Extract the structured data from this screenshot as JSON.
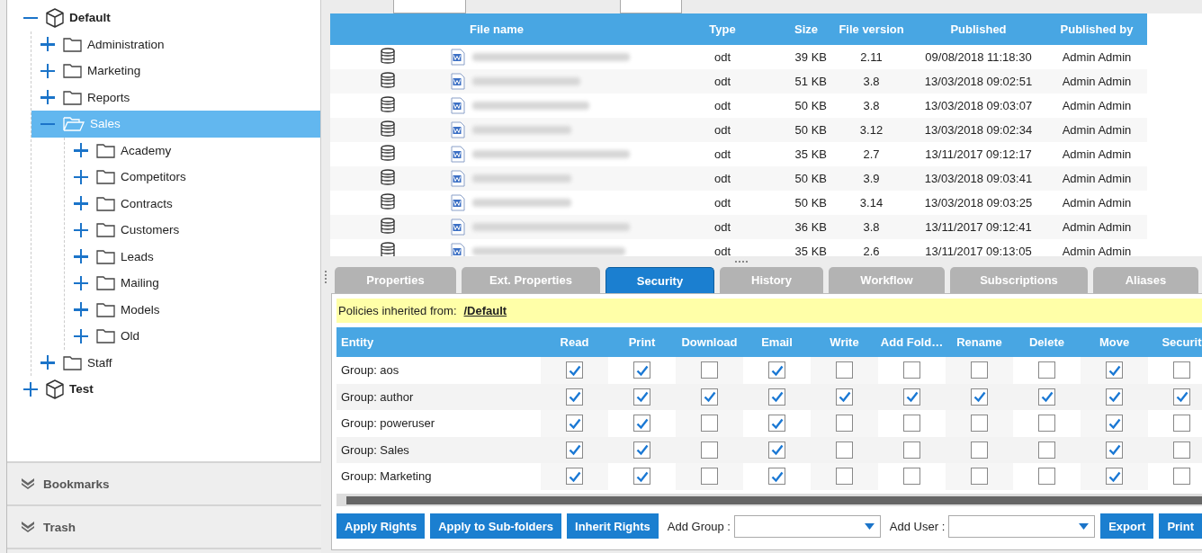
{
  "tree": [
    {
      "label": "Default",
      "kind": "repository",
      "expanded": true,
      "selected": false,
      "children": [
        {
          "label": "Administration",
          "kind": "folder",
          "expanded": false,
          "selected": false
        },
        {
          "label": "Marketing",
          "kind": "folder",
          "expanded": false,
          "selected": false
        },
        {
          "label": "Reports",
          "kind": "folder",
          "expanded": false,
          "selected": false
        },
        {
          "label": "Sales",
          "kind": "folder",
          "expanded": true,
          "selected": true,
          "children": [
            {
              "label": "Academy",
              "kind": "folder",
              "expanded": false,
              "selected": false
            },
            {
              "label": "Competitors",
              "kind": "folder",
              "expanded": false,
              "selected": false
            },
            {
              "label": "Contracts",
              "kind": "folder",
              "expanded": false,
              "selected": false
            },
            {
              "label": "Customers",
              "kind": "folder",
              "expanded": false,
              "selected": false
            },
            {
              "label": "Leads",
              "kind": "folder",
              "expanded": false,
              "selected": false
            },
            {
              "label": "Mailing",
              "kind": "folder",
              "expanded": false,
              "selected": false
            },
            {
              "label": "Models",
              "kind": "folder",
              "expanded": false,
              "selected": false
            },
            {
              "label": "Old",
              "kind": "folder",
              "expanded": false,
              "selected": false
            }
          ]
        },
        {
          "label": "Staff",
          "kind": "folder",
          "expanded": false,
          "selected": false
        }
      ]
    },
    {
      "label": "Test",
      "kind": "repository",
      "expanded": false,
      "selected": false
    }
  ],
  "side_sections": [
    {
      "label": "Bookmarks"
    },
    {
      "label": "Trash"
    }
  ],
  "files": {
    "columns": [
      "File name",
      "Type",
      "Size",
      "File version",
      "Published",
      "Published by"
    ],
    "rows": [
      {
        "type": "odt",
        "size": "39 KB",
        "version": "2.11",
        "published": "09/08/2018 11:18:30",
        "published_by": "Admin Admin"
      },
      {
        "type": "odt",
        "size": "51 KB",
        "version": "3.8",
        "published": "13/03/2018 09:02:51",
        "published_by": "Admin Admin"
      },
      {
        "type": "odt",
        "size": "50 KB",
        "version": "3.8",
        "published": "13/03/2018 09:03:07",
        "published_by": "Admin Admin"
      },
      {
        "type": "odt",
        "size": "50 KB",
        "version": "3.12",
        "published": "13/03/2018 09:02:34",
        "published_by": "Admin Admin"
      },
      {
        "type": "odt",
        "size": "35 KB",
        "version": "2.7",
        "published": "13/11/2017 09:12:17",
        "published_by": "Admin Admin"
      },
      {
        "type": "odt",
        "size": "50 KB",
        "version": "3.9",
        "published": "13/03/2018 09:03:41",
        "published_by": "Admin Admin"
      },
      {
        "type": "odt",
        "size": "50 KB",
        "version": "3.14",
        "published": "13/03/2018 09:03:25",
        "published_by": "Admin Admin"
      },
      {
        "type": "odt",
        "size": "36 KB",
        "version": "3.8",
        "published": "13/11/2017 09:12:41",
        "published_by": "Admin Admin"
      },
      {
        "type": "odt",
        "size": "35 KB",
        "version": "2.6",
        "published": "13/11/2017 09:13:05",
        "published_by": "Admin Admin"
      }
    ]
  },
  "tabs": [
    {
      "label": "Properties",
      "selected": false
    },
    {
      "label": "Ext. Properties",
      "selected": false
    },
    {
      "label": "Security",
      "selected": true
    },
    {
      "label": "History",
      "selected": false
    },
    {
      "label": "Workflow",
      "selected": false
    },
    {
      "label": "Subscriptions",
      "selected": false
    },
    {
      "label": "Aliases",
      "selected": false
    }
  ],
  "security": {
    "inherited_label": "Policies inherited from:",
    "inherited_link": "/Default",
    "columns": [
      "Entity",
      "Read",
      "Print",
      "Download",
      "Email",
      "Write",
      "Add Fold…",
      "Rename",
      "Delete",
      "Move",
      "Securit"
    ],
    "rows": [
      {
        "entity": "Group: aos",
        "rights": [
          true,
          true,
          false,
          true,
          false,
          false,
          false,
          false,
          true,
          false
        ]
      },
      {
        "entity": "Group: author",
        "rights": [
          true,
          true,
          true,
          true,
          true,
          true,
          true,
          true,
          true,
          true
        ]
      },
      {
        "entity": "Group: poweruser",
        "rights": [
          true,
          true,
          false,
          true,
          false,
          false,
          false,
          false,
          true,
          false
        ]
      },
      {
        "entity": "Group: Sales",
        "rights": [
          true,
          true,
          false,
          true,
          false,
          false,
          false,
          false,
          true,
          false
        ]
      },
      {
        "entity": "Group: Marketing",
        "rights": [
          true,
          true,
          false,
          true,
          false,
          false,
          false,
          false,
          true,
          false
        ]
      }
    ]
  },
  "actions": [
    {
      "kind": "button",
      "label": "Apply Rights"
    },
    {
      "kind": "button",
      "label": "Apply to Sub-folders"
    },
    {
      "kind": "button",
      "label": "Inherit Rights"
    },
    {
      "kind": "dropdown",
      "label": "Add Group :"
    },
    {
      "kind": "dropdown",
      "label": "Add User :"
    },
    {
      "kind": "button",
      "label": "Export"
    },
    {
      "kind": "button",
      "label": "Print"
    }
  ]
}
